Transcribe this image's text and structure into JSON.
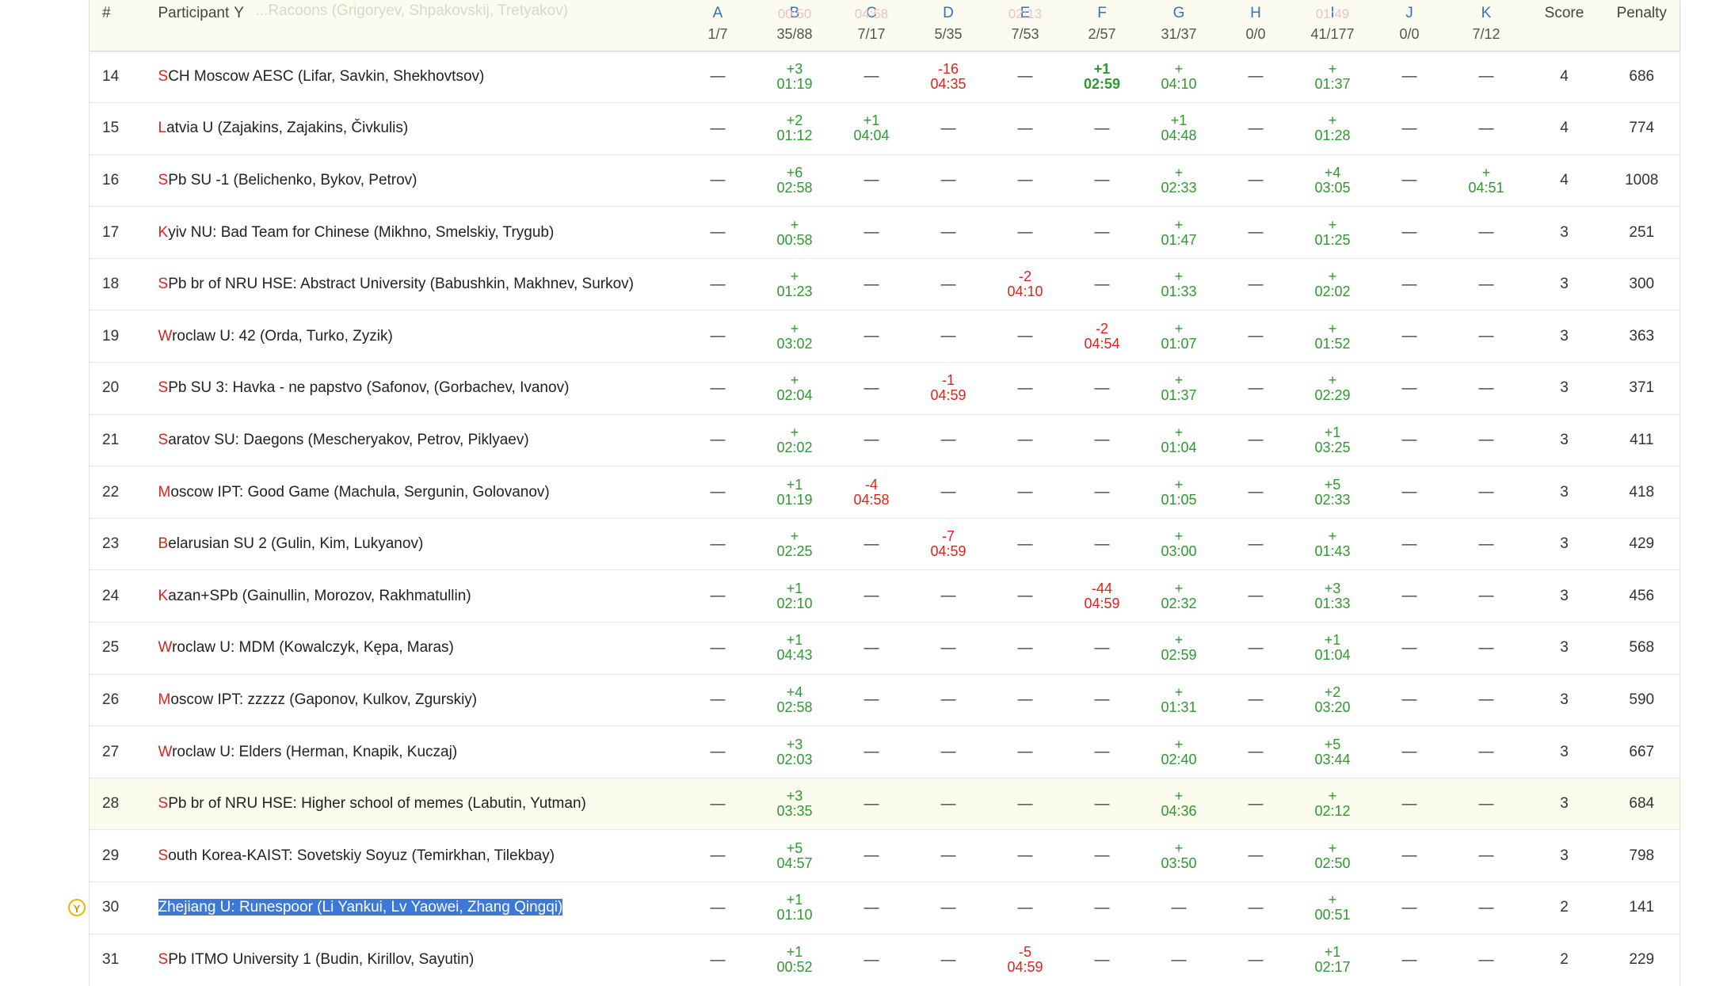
{
  "header": {
    "rank": "#",
    "participant": "Participant",
    "participant_sort": "Y",
    "ghost_row": "...Racoons (Grigoryev, Shpakovskij, Tretyakov)",
    "score": "Score",
    "penalty": "Penalty",
    "problems": [
      {
        "label": "A",
        "stat": "1/7",
        "ghost": ""
      },
      {
        "label": "B",
        "stat": "35/88",
        "ghost": "00:50"
      },
      {
        "label": "C",
        "stat": "7/17",
        "ghost": "04:58"
      },
      {
        "label": "D",
        "stat": "5/35",
        "ghost": ""
      },
      {
        "label": "E",
        "stat": "7/53",
        "ghost": "02:13"
      },
      {
        "label": "F",
        "stat": "2/57",
        "ghost": ""
      },
      {
        "label": "G",
        "stat": "31/37",
        "ghost": ""
      },
      {
        "label": "H",
        "stat": "0/0",
        "ghost": ""
      },
      {
        "label": "I",
        "stat": "41/177",
        "ghost": "01:49"
      },
      {
        "label": "J",
        "stat": "0/0",
        "ghost": ""
      },
      {
        "label": "K",
        "stat": "7/12",
        "ghost": ""
      }
    ]
  },
  "marker_icon": "Y",
  "rows": [
    {
      "rank": "14",
      "first": "S",
      "rest": "CH  Moscow AESC (Lifar, Savkin, Shekhovtsov)",
      "score": "4",
      "penalty": "686",
      "cells": [
        [
          "-"
        ],
        [
          "+3",
          "01:19",
          "ok"
        ],
        [
          "-"
        ],
        [
          "-16",
          "04:35",
          "bad"
        ],
        [
          "-"
        ],
        [
          "+1",
          "02:59",
          "okb"
        ],
        [
          "+",
          "04:10",
          "ok"
        ],
        [
          "-"
        ],
        [
          "+",
          "01:37",
          "ok"
        ],
        [
          "-"
        ],
        [
          "-"
        ]
      ]
    },
    {
      "rank": "15",
      "first": "L",
      "rest": "atvia U (Zajakins, Zajakins, Čivkulis)",
      "score": "4",
      "penalty": "774",
      "cells": [
        [
          "-"
        ],
        [
          "+2",
          "01:12",
          "ok"
        ],
        [
          "+1",
          "04:04",
          "ok"
        ],
        [
          "-"
        ],
        [
          "-"
        ],
        [
          "-"
        ],
        [
          "+1",
          "04:48",
          "ok"
        ],
        [
          "-"
        ],
        [
          "+",
          "01:28",
          "ok"
        ],
        [
          "-"
        ],
        [
          "-"
        ]
      ]
    },
    {
      "rank": "16",
      "first": "S",
      "rest": "Pb SU -1 (Belichenko, Bykov, Petrov)",
      "score": "4",
      "penalty": "1008",
      "cells": [
        [
          "-"
        ],
        [
          "+6",
          "02:58",
          "ok"
        ],
        [
          "-"
        ],
        [
          "-"
        ],
        [
          "-"
        ],
        [
          "-"
        ],
        [
          "+",
          "02:33",
          "ok"
        ],
        [
          "-"
        ],
        [
          "+4",
          "03:05",
          "ok"
        ],
        [
          "-"
        ],
        [
          "+",
          "04:51",
          "ok"
        ]
      ]
    },
    {
      "rank": "17",
      "first": "K",
      "rest": "yiv NU: Bad Team for Chinese (Mikhno, Smelskiy, Trygub)",
      "score": "3",
      "penalty": "251",
      "cells": [
        [
          "-"
        ],
        [
          "+",
          "00:58",
          "ok"
        ],
        [
          "-"
        ],
        [
          "-"
        ],
        [
          "-"
        ],
        [
          "-"
        ],
        [
          "+",
          "01:47",
          "ok"
        ],
        [
          "-"
        ],
        [
          "+",
          "01:25",
          "ok"
        ],
        [
          "-"
        ],
        [
          "-"
        ]
      ]
    },
    {
      "rank": "18",
      "first": "S",
      "rest": "Pb br of NRU HSE: Abstract University (Babushkin, Makhnev, Surkov)",
      "score": "3",
      "penalty": "300",
      "cells": [
        [
          "-"
        ],
        [
          "+",
          "01:23",
          "ok"
        ],
        [
          "-"
        ],
        [
          "-"
        ],
        [
          "-2",
          "04:10",
          "bad"
        ],
        [
          "-"
        ],
        [
          "+",
          "01:33",
          "ok"
        ],
        [
          "-"
        ],
        [
          "+",
          "02:02",
          "ok"
        ],
        [
          "-"
        ],
        [
          "-"
        ]
      ]
    },
    {
      "rank": "19",
      "first": "W",
      "rest": "roclaw U: 42 (Orda, Turko, Zyzik)",
      "score": "3",
      "penalty": "363",
      "cells": [
        [
          "-"
        ],
        [
          "+",
          "03:02",
          "ok"
        ],
        [
          "-"
        ],
        [
          "-"
        ],
        [
          "-"
        ],
        [
          "-2",
          "04:54",
          "bad"
        ],
        [
          "+",
          "01:07",
          "ok"
        ],
        [
          "-"
        ],
        [
          "+",
          "01:52",
          "ok"
        ],
        [
          "-"
        ],
        [
          "-"
        ]
      ]
    },
    {
      "rank": "20",
      "first": "S",
      "rest": "Pb SU 3: Havka - ne papstvo (Safonov, (Gorbachev, Ivanov)",
      "score": "3",
      "penalty": "371",
      "cells": [
        [
          "-"
        ],
        [
          "+",
          "02:04",
          "ok"
        ],
        [
          "-"
        ],
        [
          "-1",
          "04:59",
          "bad"
        ],
        [
          "-"
        ],
        [
          "-"
        ],
        [
          "+",
          "01:37",
          "ok"
        ],
        [
          "-"
        ],
        [
          "+",
          "02:29",
          "ok"
        ],
        [
          "-"
        ],
        [
          "-"
        ]
      ]
    },
    {
      "rank": "21",
      "first": "S",
      "rest": "aratov SU: Daegons (Mescheryakov, Petrov, Piklyaev)",
      "score": "3",
      "penalty": "411",
      "cells": [
        [
          "-"
        ],
        [
          "+",
          "02:02",
          "ok"
        ],
        [
          "-"
        ],
        [
          "-"
        ],
        [
          "-"
        ],
        [
          "-"
        ],
        [
          "+",
          "01:04",
          "ok"
        ],
        [
          "-"
        ],
        [
          "+1",
          "03:25",
          "ok"
        ],
        [
          "-"
        ],
        [
          "-"
        ]
      ]
    },
    {
      "rank": "22",
      "first": "M",
      "rest": "oscow IPT: Good Game (Machula, Sergunin, Golovanov)",
      "score": "3",
      "penalty": "418",
      "cells": [
        [
          "-"
        ],
        [
          "+1",
          "01:19",
          "ok"
        ],
        [
          "-4",
          "04:58",
          "bad"
        ],
        [
          "-"
        ],
        [
          "-"
        ],
        [
          "-"
        ],
        [
          "+",
          "01:05",
          "ok"
        ],
        [
          "-"
        ],
        [
          "+5",
          "02:33",
          "ok"
        ],
        [
          "-"
        ],
        [
          "-"
        ]
      ]
    },
    {
      "rank": "23",
      "first": "B",
      "rest": "elarusian SU 2 (Gulin, Kim, Lukyanov)",
      "score": "3",
      "penalty": "429",
      "cells": [
        [
          "-"
        ],
        [
          "+",
          "02:25",
          "ok"
        ],
        [
          "-"
        ],
        [
          "-7",
          "04:59",
          "bad"
        ],
        [
          "-"
        ],
        [
          "-"
        ],
        [
          "+",
          "03:00",
          "ok"
        ],
        [
          "-"
        ],
        [
          "+",
          "01:43",
          "ok"
        ],
        [
          "-"
        ],
        [
          "-"
        ]
      ]
    },
    {
      "rank": "24",
      "first": "K",
      "rest": "azan+SPb (Gainullin, Morozov, Rakhmatullin)",
      "score": "3",
      "penalty": "456",
      "cells": [
        [
          "-"
        ],
        [
          "+1",
          "02:10",
          "ok"
        ],
        [
          "-"
        ],
        [
          "-"
        ],
        [
          "-"
        ],
        [
          "-44",
          "04:59",
          "bad"
        ],
        [
          "+",
          "02:32",
          "ok"
        ],
        [
          "-"
        ],
        [
          "+3",
          "01:33",
          "ok"
        ],
        [
          "-"
        ],
        [
          "-"
        ]
      ]
    },
    {
      "rank": "25",
      "first": "W",
      "rest": "roclaw U: MDM (Kowalczyk, Kępa, Maras)",
      "score": "3",
      "penalty": "568",
      "cells": [
        [
          "-"
        ],
        [
          "+1",
          "04:43",
          "ok"
        ],
        [
          "-"
        ],
        [
          "-"
        ],
        [
          "-"
        ],
        [
          "-"
        ],
        [
          "+",
          "02:59",
          "ok"
        ],
        [
          "-"
        ],
        [
          "+1",
          "01:04",
          "ok"
        ],
        [
          "-"
        ],
        [
          "-"
        ]
      ]
    },
    {
      "rank": "26",
      "first": "M",
      "rest": "oscow IPT: zzzzz (Gaponov, Kulkov, Zgurskiy)",
      "score": "3",
      "penalty": "590",
      "cells": [
        [
          "-"
        ],
        [
          "+4",
          "02:58",
          "ok"
        ],
        [
          "-"
        ],
        [
          "-"
        ],
        [
          "-"
        ],
        [
          "-"
        ],
        [
          "+",
          "01:31",
          "ok"
        ],
        [
          "-"
        ],
        [
          "+2",
          "03:20",
          "ok"
        ],
        [
          "-"
        ],
        [
          "-"
        ]
      ]
    },
    {
      "rank": "27",
      "first": "W",
      "rest": "roclaw U: Elders (Herman, Knapik, Kuczaj)",
      "score": "3",
      "penalty": "667",
      "cells": [
        [
          "-"
        ],
        [
          "+3",
          "02:03",
          "ok"
        ],
        [
          "-"
        ],
        [
          "-"
        ],
        [
          "-"
        ],
        [
          "-"
        ],
        [
          "+",
          "02:40",
          "ok"
        ],
        [
          "-"
        ],
        [
          "+5",
          "03:44",
          "ok"
        ],
        [
          "-"
        ],
        [
          "-"
        ]
      ]
    },
    {
      "rank": "28",
      "first": "S",
      "rest": "Pb br of NRU HSE: Higher school of memes (Labutin, Yutman)",
      "score": "3",
      "penalty": "684",
      "highlight": true,
      "cells": [
        [
          "-"
        ],
        [
          "+3",
          "03:35",
          "ok"
        ],
        [
          "-"
        ],
        [
          "-"
        ],
        [
          "-"
        ],
        [
          "-"
        ],
        [
          "+",
          "04:36",
          "ok"
        ],
        [
          "-"
        ],
        [
          "+",
          "02:12",
          "ok"
        ],
        [
          "-"
        ],
        [
          "-"
        ]
      ]
    },
    {
      "rank": "29",
      "first": "S",
      "rest": "outh Korea-KAIST: Sovetskiy Soyuz (Temirkhan, Tilekbay)",
      "score": "3",
      "penalty": "798",
      "cells": [
        [
          "-"
        ],
        [
          "+5",
          "04:57",
          "ok"
        ],
        [
          "-"
        ],
        [
          "-"
        ],
        [
          "-"
        ],
        [
          "-"
        ],
        [
          "+",
          "03:50",
          "ok"
        ],
        [
          "-"
        ],
        [
          "+",
          "02:50",
          "ok"
        ],
        [
          "-"
        ],
        [
          "-"
        ]
      ]
    },
    {
      "rank": "30",
      "first": "",
      "rest": "Zhejiang U: Runespoor (Li Yankui, Lv Yaowei, Zhang Qingqi)",
      "score": "2",
      "penalty": "141",
      "selected": true,
      "cells": [
        [
          "-"
        ],
        [
          "+1",
          "01:10",
          "ok"
        ],
        [
          "-"
        ],
        [
          "-"
        ],
        [
          "-"
        ],
        [
          "-"
        ],
        [
          "-"
        ],
        [
          "-"
        ],
        [
          "+",
          "00:51",
          "ok"
        ],
        [
          "-"
        ],
        [
          "-"
        ]
      ]
    },
    {
      "rank": "31",
      "first": "S",
      "rest": "Pb ITMO University 1 (Budin, Kirillov, Sayutin)",
      "score": "2",
      "penalty": "229",
      "cells": [
        [
          "-"
        ],
        [
          "+1",
          "00:52",
          "ok"
        ],
        [
          "-"
        ],
        [
          "-"
        ],
        [
          "-5",
          "04:59",
          "bad"
        ],
        [
          "-"
        ],
        [
          "-"
        ],
        [
          "-"
        ],
        [
          "+1",
          "02:17",
          "ok"
        ],
        [
          "-"
        ],
        [
          "-"
        ]
      ]
    }
  ]
}
